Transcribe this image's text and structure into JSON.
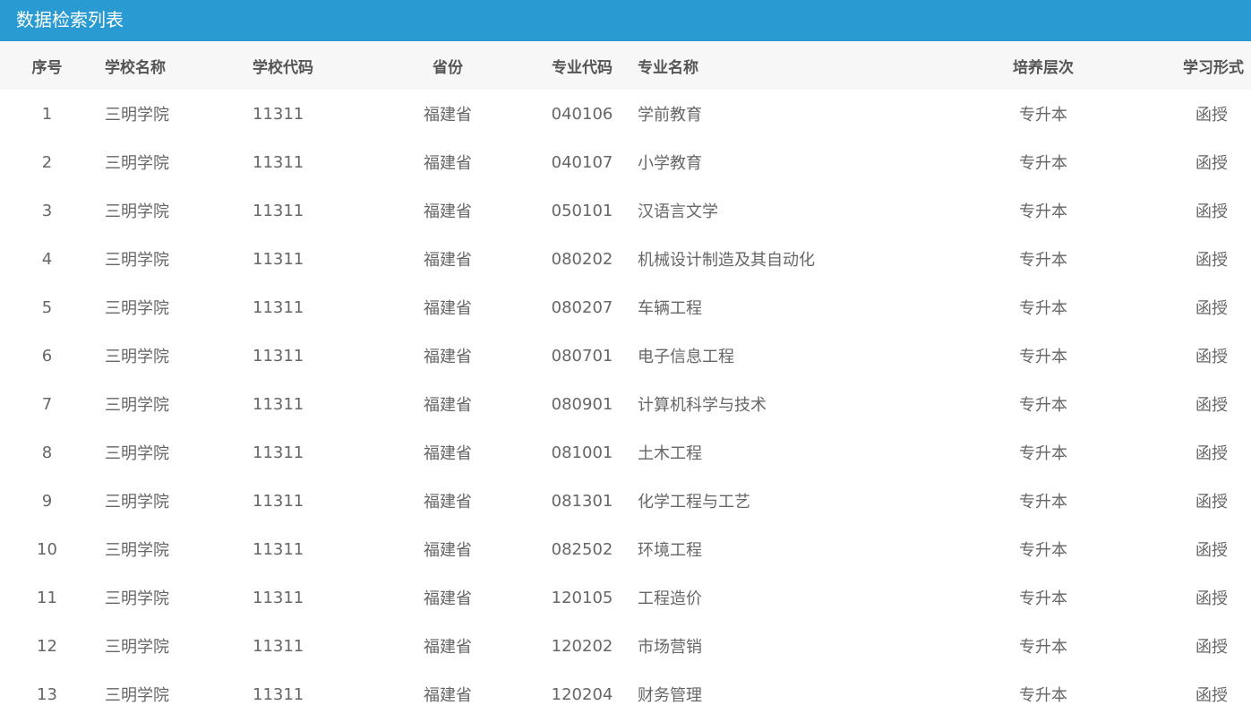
{
  "header": {
    "title": "数据检索列表"
  },
  "table": {
    "columns": [
      "序号",
      "学校名称",
      "学校代码",
      "省份",
      "专业代码",
      "专业名称",
      "培养层次",
      "学习形式"
    ],
    "rows": [
      [
        "1",
        "三明学院",
        "11311",
        "福建省",
        "040106",
        "学前教育",
        "专升本",
        "函授"
      ],
      [
        "2",
        "三明学院",
        "11311",
        "福建省",
        "040107",
        "小学教育",
        "专升本",
        "函授"
      ],
      [
        "3",
        "三明学院",
        "11311",
        "福建省",
        "050101",
        "汉语言文学",
        "专升本",
        "函授"
      ],
      [
        "4",
        "三明学院",
        "11311",
        "福建省",
        "080202",
        "机械设计制造及其自动化",
        "专升本",
        "函授"
      ],
      [
        "5",
        "三明学院",
        "11311",
        "福建省",
        "080207",
        "车辆工程",
        "专升本",
        "函授"
      ],
      [
        "6",
        "三明学院",
        "11311",
        "福建省",
        "080701",
        "电子信息工程",
        "专升本",
        "函授"
      ],
      [
        "7",
        "三明学院",
        "11311",
        "福建省",
        "080901",
        "计算机科学与技术",
        "专升本",
        "函授"
      ],
      [
        "8",
        "三明学院",
        "11311",
        "福建省",
        "081001",
        "土木工程",
        "专升本",
        "函授"
      ],
      [
        "9",
        "三明学院",
        "11311",
        "福建省",
        "081301",
        "化学工程与工艺",
        "专升本",
        "函授"
      ],
      [
        "10",
        "三明学院",
        "11311",
        "福建省",
        "082502",
        "环境工程",
        "专升本",
        "函授"
      ],
      [
        "11",
        "三明学院",
        "11311",
        "福建省",
        "120105",
        "工程造价",
        "专升本",
        "函授"
      ],
      [
        "12",
        "三明学院",
        "11311",
        "福建省",
        "120202",
        "市场营销",
        "专升本",
        "函授"
      ],
      [
        "13",
        "三明学院",
        "11311",
        "福建省",
        "120204",
        "财务管理",
        "专升本",
        "函授"
      ]
    ]
  },
  "colors": {
    "header_bg": "#2a9bd2",
    "table_head_bg": "#f7f7f7"
  }
}
